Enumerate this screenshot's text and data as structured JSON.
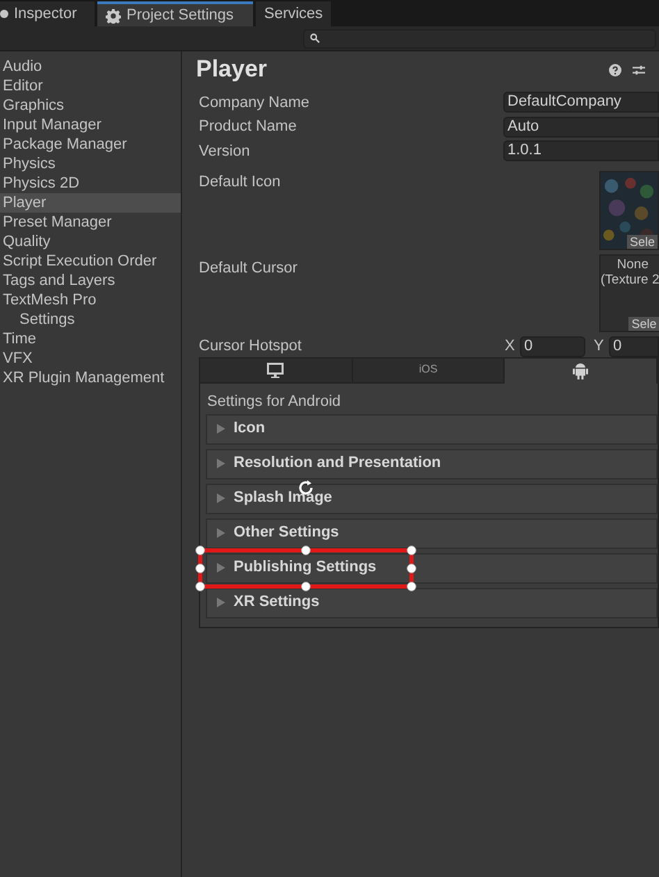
{
  "tabs": [
    {
      "label": "Inspector",
      "kind": "dot",
      "selected": false
    },
    {
      "label": "Project Settings",
      "kind": "gear",
      "selected": true
    },
    {
      "label": "Services",
      "kind": "none",
      "selected": false
    }
  ],
  "sidebar": {
    "items": [
      {
        "label": "Audio",
        "selected": false
      },
      {
        "label": "Editor",
        "selected": false
      },
      {
        "label": "Graphics",
        "selected": false
      },
      {
        "label": "Input Manager",
        "selected": false
      },
      {
        "label": "Package Manager",
        "selected": false
      },
      {
        "label": "Physics",
        "selected": false
      },
      {
        "label": "Physics 2D",
        "selected": false
      },
      {
        "label": "Player",
        "selected": true
      },
      {
        "label": "Preset Manager",
        "selected": false
      },
      {
        "label": "Quality",
        "selected": false
      },
      {
        "label": "Script Execution Order",
        "selected": false
      },
      {
        "label": "Tags and Layers",
        "selected": false
      },
      {
        "label": "TextMesh Pro",
        "selected": false,
        "children": [
          {
            "label": "Settings",
            "selected": false
          }
        ]
      },
      {
        "label": "Time",
        "selected": false
      },
      {
        "label": "VFX",
        "selected": false
      },
      {
        "label": "XR Plugin Management",
        "selected": false
      }
    ]
  },
  "panel": {
    "title": "Player",
    "fields": [
      {
        "label": "Company Name",
        "value": "DefaultCompany"
      },
      {
        "label": "Product Name",
        "value": "Auto"
      },
      {
        "label": "Version",
        "value": "1.0.1"
      }
    ],
    "default_icon": {
      "label": "Default Icon",
      "button": "Sele"
    },
    "default_cursor": {
      "label": "Default Cursor",
      "value_lines": [
        "None",
        "(Texture 2"
      ],
      "button": "Sele"
    },
    "cursor_hotspot": {
      "label": "Cursor Hotspot",
      "x_label": "X",
      "x_value": "0",
      "y_label": "Y",
      "y_value": "0"
    },
    "platform_tabs": [
      {
        "kind": "monitor",
        "selected": false
      },
      {
        "kind": "text",
        "label": "iOS",
        "selected": false
      },
      {
        "kind": "android",
        "selected": true
      }
    ],
    "platform_heading": "Settings for Android",
    "sections": [
      {
        "label": "Icon",
        "highlighted": false
      },
      {
        "label": "Resolution and Presentation",
        "highlighted": false
      },
      {
        "label": "Splash Image",
        "highlighted": false
      },
      {
        "label": "Other Settings",
        "highlighted": false
      },
      {
        "label": "Publishing Settings",
        "highlighted": true
      },
      {
        "label": "XR Settings",
        "highlighted": false
      }
    ]
  }
}
